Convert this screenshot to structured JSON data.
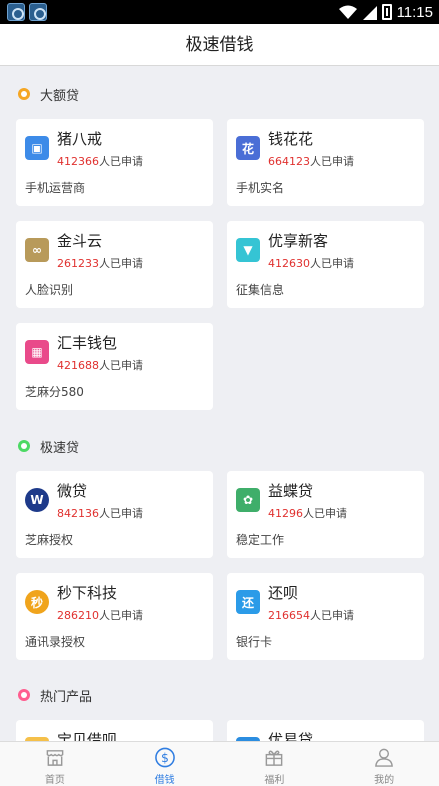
{
  "status_bar": {
    "time": "11:15",
    "app_icons": [
      "app-icon",
      "app-icon"
    ]
  },
  "header": {
    "title": "极速借钱"
  },
  "sections": [
    {
      "title": "大额贷",
      "dot_color": "#f5a623",
      "cards": [
        {
          "name": "猪八戒",
          "count": "412366",
          "count_suffix": "人已申请",
          "desc": "手机运营商",
          "logo_color": "#3d8be8",
          "logo_glyph": "▣"
        },
        {
          "name": "钱花花",
          "count": "664123",
          "count_suffix": "人已申请",
          "desc": "手机实名",
          "logo_color": "#4a6ed6",
          "logo_glyph": "花"
        },
        {
          "name": "金斗云",
          "count": "261233",
          "count_suffix": "人已申请",
          "desc": "人脸识别",
          "logo_color": "#b89a5a",
          "logo_glyph": "∞"
        },
        {
          "name": "优享新客",
          "count": "412630",
          "count_suffix": "人已申请",
          "desc": "征集信息",
          "logo_color": "#35c4d4",
          "logo_glyph": "▼"
        },
        {
          "name": "汇丰钱包",
          "count": "421688",
          "count_suffix": "人已申请",
          "desc": "芝麻分580",
          "logo_color": "#e94a8a",
          "logo_glyph": "▦"
        }
      ]
    },
    {
      "title": "极速贷",
      "dot_color": "#4cd964",
      "cards": [
        {
          "name": "微贷",
          "count": "842136",
          "count_suffix": "人已申请",
          "desc": "芝麻授权",
          "logo_color": "#1e3a8a",
          "logo_glyph": "W"
        },
        {
          "name": "益蝶贷",
          "count": "41296",
          "count_suffix": "人已申请",
          "desc": "稳定工作",
          "logo_color": "#3fae6a",
          "logo_glyph": "✿"
        },
        {
          "name": "秒下科技",
          "count": "286210",
          "count_suffix": "人已申请",
          "desc": "通讯录授权",
          "logo_color": "#f0a41c",
          "logo_glyph": "秒"
        },
        {
          "name": "还呗",
          "count": "216654",
          "count_suffix": "人已申请",
          "desc": "银行卡",
          "logo_color": "#2b9be8",
          "logo_glyph": "还"
        }
      ]
    },
    {
      "title": "热门产品",
      "dot_color": "#ff5d8f",
      "cards": [
        {
          "name": "宝贝借呗",
          "count": "",
          "count_suffix": "",
          "desc": "",
          "logo_color": "#f5c04a",
          "logo_glyph": ""
        },
        {
          "name": "优易贷",
          "count": "",
          "count_suffix": "",
          "desc": "",
          "logo_color": "#2b8de0",
          "logo_glyph": ""
        }
      ]
    }
  ],
  "tabs": [
    {
      "label": "首页",
      "icon": "store-icon",
      "active": false
    },
    {
      "label": "借钱",
      "icon": "dollar-icon",
      "active": true
    },
    {
      "label": "福利",
      "icon": "gift-icon",
      "active": false
    },
    {
      "label": "我的",
      "icon": "person-icon",
      "active": false
    }
  ],
  "colors": {
    "accent": "#2f7de1",
    "count_red": "#e0312f",
    "background": "#eeeff3"
  }
}
